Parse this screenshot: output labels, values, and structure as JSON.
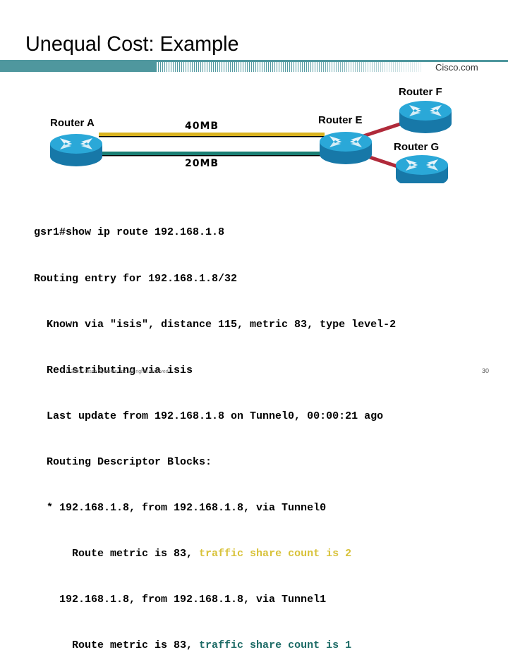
{
  "slide": {
    "title": "Unequal Cost: Example",
    "logo": "Cisco.com",
    "footer": "© 2001, Cisco Systems, Inc. All rights reserved.",
    "page_number": "30"
  },
  "colors": {
    "banner": "#4f979e",
    "link_40mb": "#d9b320",
    "link_20mb": "#1a7f74",
    "link_red": "#b02a3a",
    "router_top": "#28a8d8",
    "router_side": "#1778a8",
    "highlight_gold": "#d8c23a",
    "highlight_teal": "#1d6b66"
  },
  "diagram": {
    "routers": [
      {
        "id": "A",
        "label": "Router A"
      },
      {
        "id": "E",
        "label": "Router E"
      },
      {
        "id": "F",
        "label": "Router F"
      },
      {
        "id": "G",
        "label": "Router G"
      }
    ],
    "links": [
      {
        "from": "A",
        "to": "E",
        "label": "40MB",
        "color": "gold"
      },
      {
        "from": "A",
        "to": "E",
        "label": "20MB",
        "color": "teal"
      },
      {
        "from": "E",
        "to": "F",
        "label": "",
        "color": "red"
      },
      {
        "from": "E",
        "to": "G",
        "label": "",
        "color": "red"
      }
    ]
  },
  "cli": {
    "lines": [
      {
        "text": "gsr1#show ip route 192.168.1.8"
      },
      {
        "text": "Routing entry for 192.168.1.8/32"
      },
      {
        "text": "  Known via \"isis\", distance 115, metric 83, type level-2"
      },
      {
        "text": "  Redistributing via isis"
      },
      {
        "text": "  Last update from 192.168.1.8 on Tunnel0, 00:00:21 ago"
      },
      {
        "text": "  Routing Descriptor Blocks:"
      },
      {
        "text": "  * 192.168.1.8, from 192.168.1.8, via Tunnel0"
      },
      {
        "prefix": "      Route metric is 83, ",
        "highlight": "traffic share count is 2",
        "hl": "gold"
      },
      {
        "text": "    192.168.1.8, from 192.168.1.8, via Tunnel1"
      },
      {
        "prefix": "      Route metric is 83, ",
        "highlight": "traffic share count is 1",
        "hl": "teal"
      }
    ]
  }
}
